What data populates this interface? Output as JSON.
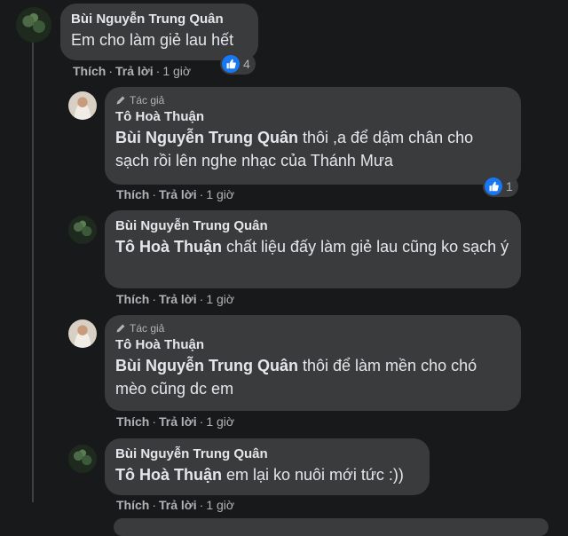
{
  "actions": {
    "like": "Thích",
    "reply": "Trả lời",
    "separator": "·"
  },
  "author_badge": "Tác giả",
  "comments": [
    {
      "name": "Bùi Nguyễn Trung Quân",
      "text": "Em cho làm giẻ lau hết",
      "time": "1 giờ",
      "reaction_count": "4"
    },
    {
      "name": "Tô Hoà Thuận",
      "mention": "Bùi Nguyễn Trung Quân",
      "text": " thôi ,a để dậm chân cho sạch rồi lên nghe nhạc của Thánh Mưa",
      "time": "1 giờ",
      "reaction_count": "1"
    },
    {
      "name": "Bùi Nguyễn Trung Quân",
      "mention": "Tô Hoà Thuận",
      "text": " chất liệu đấy làm giẻ lau cũng ko sạch ý",
      "time": "1 giờ"
    },
    {
      "name": "Tô Hoà Thuận",
      "mention": "Bùi Nguyễn Trung Quân",
      "text": " thôi để làm mền cho chó mèo cũng dc em",
      "time": "1 giờ"
    },
    {
      "name": "Bùi Nguyễn Trung Quân",
      "mention": "Tô Hoà Thuận",
      "text": " em lại ko nuôi mới tức :))",
      "time": "1 giờ"
    }
  ]
}
